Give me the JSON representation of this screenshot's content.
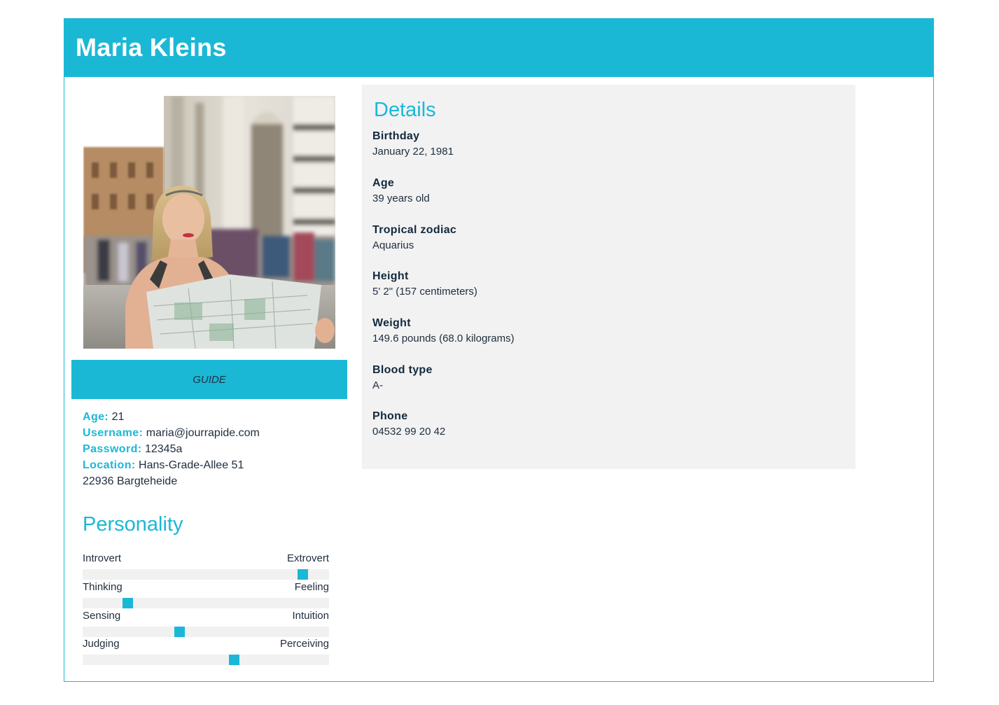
{
  "profile": {
    "name": "Maria Kleins",
    "role_label": "GUIDE"
  },
  "info": {
    "age_label": "Age:",
    "age_value": "21",
    "username_label": "Username:",
    "username_value": "maria@jourrapide.com",
    "password_label": "Password:",
    "password_value": "12345a",
    "location_label": "Location:",
    "location_line1": "Hans-Grade-Allee 51",
    "location_line2": "22936 Bargteheide"
  },
  "personality": {
    "title": "Personality",
    "traits": [
      {
        "left": "Introvert",
        "right": "Extrovert",
        "level": 0.91
      },
      {
        "left": "Thinking",
        "right": "Feeling",
        "level": 0.17
      },
      {
        "left": "Sensing",
        "right": "Intuition",
        "level": 0.39
      },
      {
        "left": "Judging",
        "right": "Perceiving",
        "level": 0.62
      }
    ]
  },
  "details": {
    "title": "Details",
    "items": [
      {
        "label": "Birthday",
        "value": "January 22, 1981"
      },
      {
        "label": "Age",
        "value": "39 years old"
      },
      {
        "label": "Tropical zodiac",
        "value": "Aquarius"
      },
      {
        "label": "Height",
        "value": "5' 2\" (157 centimeters)"
      },
      {
        "label": "Weight",
        "value": "149.6 pounds (68.0 kilograms)"
      },
      {
        "label": "Blood type",
        "value": "A-"
      },
      {
        "label": "Phone",
        "value": "04532 99 20 42"
      }
    ]
  },
  "colors": {
    "accent": "#1bb8d6",
    "panel": "#f2f2f2",
    "track": "#f1f1f2"
  }
}
